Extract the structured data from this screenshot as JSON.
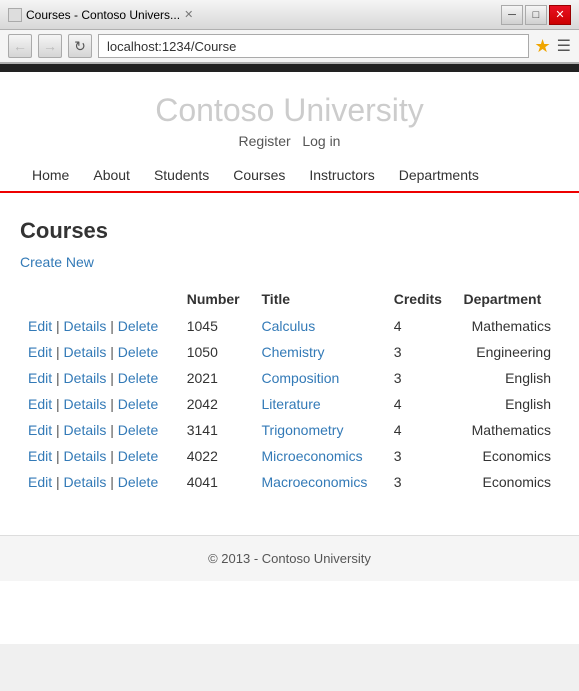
{
  "browser": {
    "tab_title": "Courses - Contoso Univers...",
    "url": "localhost:1234/Course",
    "minimize_label": "─",
    "restore_label": "□",
    "close_label": "✕"
  },
  "site": {
    "title": "Contoso University",
    "auth": {
      "register": "Register",
      "login": "Log in"
    },
    "nav": [
      "Home",
      "About",
      "Students",
      "Courses",
      "Instructors",
      "Departments"
    ]
  },
  "page": {
    "heading": "Courses",
    "create_new": "Create New",
    "table": {
      "headers": [
        "Number",
        "Title",
        "Credits",
        "Department"
      ],
      "rows": [
        {
          "number": "1045",
          "title": "Calculus",
          "credits": "4",
          "department": "Mathematics"
        },
        {
          "number": "1050",
          "title": "Chemistry",
          "credits": "3",
          "department": "Engineering"
        },
        {
          "number": "2021",
          "title": "Composition",
          "credits": "3",
          "department": "English"
        },
        {
          "number": "2042",
          "title": "Literature",
          "credits": "4",
          "department": "English"
        },
        {
          "number": "3141",
          "title": "Trigonometry",
          "credits": "4",
          "department": "Mathematics"
        },
        {
          "number": "4022",
          "title": "Microeconomics",
          "credits": "3",
          "department": "Economics"
        },
        {
          "number": "4041",
          "title": "Macroeconomics",
          "credits": "3",
          "department": "Economics"
        }
      ],
      "actions": [
        "Edit",
        "Details",
        "Delete"
      ]
    }
  },
  "footer": {
    "text": "© 2013 - Contoso University"
  }
}
